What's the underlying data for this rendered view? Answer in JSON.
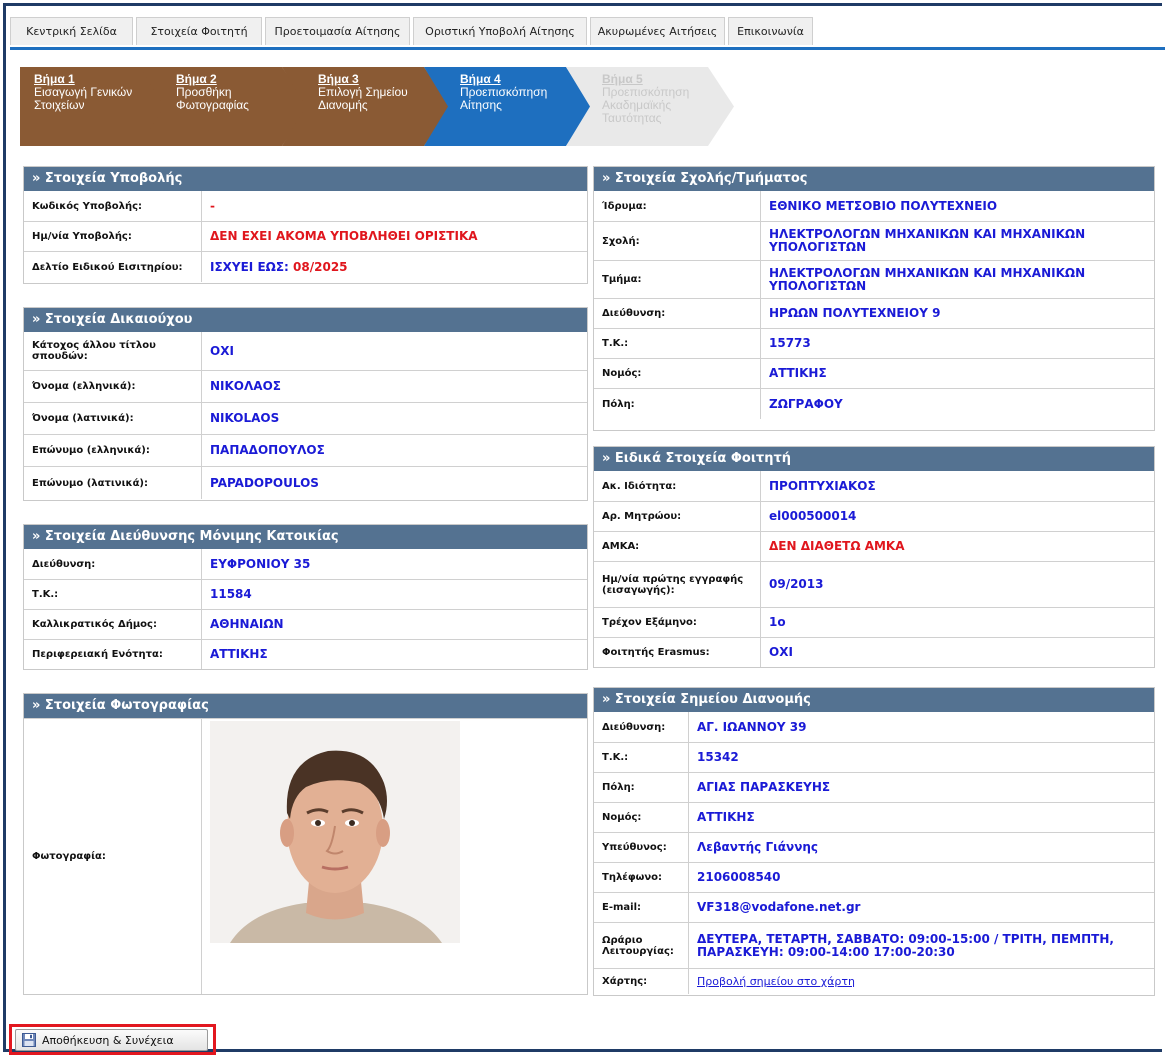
{
  "nav": {
    "tabs": [
      "Κεντρική Σελίδα",
      "Στοιχεία Φοιτητή",
      "Προετοιμασία Αίτησης",
      "Οριστική Υποβολή Αίτησης",
      "Ακυρωμένες Αιτήσεις",
      "Επικοινωνία"
    ]
  },
  "steps": [
    {
      "num": "Βήμα 1",
      "text": "Εισαγωγή Γενικών\nΣτοιχείων",
      "state": "done"
    },
    {
      "num": "Βήμα 2",
      "text": "Προσθήκη\nΦωτογραφίας",
      "state": "done"
    },
    {
      "num": "Βήμα 3",
      "text": "Επιλογή Σημείου\nΔιανομής",
      "state": "done"
    },
    {
      "num": "Βήμα 4",
      "text": "Προεπισκόπηση\nΑίτησης",
      "state": "current"
    },
    {
      "num": "Βήμα 5",
      "text": "Προεπισκόπηση\nΑκαδημαϊκής\nΤαυτότητας",
      "state": "disabled"
    }
  ],
  "submission": {
    "title": "» Στοιχεία Υποβολής",
    "code_label": "Κωδικός Υποβολής:",
    "code_value": "-",
    "date_label": "Ημ/νία Υποβολής:",
    "date_value": "ΔΕΝ ΕΧΕΙ ΑΚΟΜΑ ΥΠΟΒΛΗΘΕΙ ΟΡΙΣΤΙΚΑ",
    "ticket_label": "Δελτίο Ειδικού Εισιτηρίου:",
    "ticket_prefix": "ΙΣΧΥΕΙ ΕΩΣ:",
    "ticket_value": "08/2025"
  },
  "beneficiary": {
    "title": "» Στοιχεία Δικαιούχου",
    "rows": [
      {
        "label": "Κάτοχος άλλου τίτλου σπουδών:",
        "value": "ΟΧΙ"
      },
      {
        "label": "Όνομα (ελληνικά):",
        "value": "ΝΙΚΟΛΑΟΣ"
      },
      {
        "label": "Όνομα (λατινικά):",
        "value": "NIKOLAOS"
      },
      {
        "label": "Επώνυμο (ελληνικά):",
        "value": "ΠΑΠΑΔΟΠΟΥΛΟΣ"
      },
      {
        "label": "Επώνυμο (λατινικά):",
        "value": "PAPADOPOULOS"
      }
    ]
  },
  "residence": {
    "title": "» Στοιχεία Διεύθυνσης Μόνιμης Κατοικίας",
    "rows": [
      {
        "label": "Διεύθυνση:",
        "value": "ΕΥΦΡΟΝΙΟΥ 35"
      },
      {
        "label": "Τ.Κ.:",
        "value": "11584"
      },
      {
        "label": "Καλλικρατικός Δήμος:",
        "value": "ΑΘΗΝΑΙΩΝ"
      },
      {
        "label": "Περιφερειακή Ενότητα:",
        "value": "ΑΤΤΙΚΗΣ"
      }
    ]
  },
  "photo": {
    "title": "» Στοιχεία Φωτογραφίας",
    "label": "Φωτογραφία:"
  },
  "school": {
    "title": "» Στοιχεία Σχολής/Τμήματος",
    "rows": [
      {
        "label": "Ίδρυμα:",
        "value": "ΕΘΝΙΚΟ ΜΕΤΣΟΒΙΟ ΠΟΛΥΤΕΧΝΕΙΟ"
      },
      {
        "label": "Σχολή:",
        "value": "ΗΛΕΚΤΡΟΛΟΓΩΝ ΜΗΧΑΝΙΚΩΝ ΚΑΙ ΜΗΧΑΝΙΚΩΝ ΥΠΟΛΟΓΙΣΤΩΝ"
      },
      {
        "label": "Τμήμα:",
        "value": "ΗΛΕΚΤΡΟΛΟΓΩΝ ΜΗΧΑΝΙΚΩΝ ΚΑΙ ΜΗΧΑΝΙΚΩΝ ΥΠΟΛΟΓΙΣΤΩΝ"
      },
      {
        "label": "Διεύθυνση:",
        "value": "ΗΡΩΩΝ ΠΟΛΥΤΕΧΝΕΙΟΥ 9"
      },
      {
        "label": "Τ.Κ.:",
        "value": "15773"
      },
      {
        "label": "Νομός:",
        "value": "ΑΤΤΙΚΗΣ"
      },
      {
        "label": "Πόλη:",
        "value": "ΖΩΓΡΑΦΟΥ"
      }
    ]
  },
  "student": {
    "title": "» Ειδικά Στοιχεία Φοιτητή",
    "rows": [
      {
        "label": "Ακ. Ιδιότητα:",
        "value": "ΠΡΟΠΤΥΧΙΑΚΟΣ"
      },
      {
        "label": "Αρ. Μητρώου:",
        "value": "el000500014"
      },
      {
        "label": "ΑΜΚΑ:",
        "value": "ΔΕΝ ΔΙΑΘΕΤΩ ΑΜΚΑ"
      },
      {
        "label": "Ημ/νία πρώτης εγγραφής (εισαγωγής):",
        "value": "09/2013"
      },
      {
        "label": "Τρέχον Εξάμηνο:",
        "value": "1ο"
      },
      {
        "label": "Φοιτητής Erasmus:",
        "value": "ΟΧΙ"
      }
    ]
  },
  "delivery": {
    "title": "» Στοιχεία Σημείου Διανομής",
    "rows": [
      {
        "label": "Διεύθυνση:",
        "value": "ΑΓ. ΙΩΑΝΝΟΥ 39"
      },
      {
        "label": "Τ.Κ.:",
        "value": "15342"
      },
      {
        "label": "Πόλη:",
        "value": "ΑΓΙΑΣ ΠΑΡΑΣΚΕΥΗΣ"
      },
      {
        "label": "Νομός:",
        "value": "ΑΤΤΙΚΗΣ"
      },
      {
        "label": "Υπεύθυνος:",
        "value": "Λεβαντής Γιάννης"
      },
      {
        "label": "Τηλέφωνο:",
        "value": "2106008540"
      },
      {
        "label": "E-mail:",
        "value": "VF318@vodafone.net.gr"
      },
      {
        "label": "Ωράριο Λειτουργίας:",
        "value": "ΔΕΥΤΕΡΑ, ΤΕΤΑΡΤΗ, ΣΑΒΒΑΤΟ: 09:00-15:00 / ΤΡΙΤΗ, ΠΕΜΠΤΗ, ΠΑΡΑΣΚΕΥΗ: 09:00-14:00 17:00-20:30"
      },
      {
        "label": "Χάρτης:",
        "value": "Προβολή σημείου στο χάρτη"
      }
    ]
  },
  "save_button": {
    "label": "Αποθήκευση & Συνέχεια",
    "icon": "floppy-disk-icon"
  },
  "colors": {
    "panel_header": "#547291",
    "value_blue": "#1a1ad6",
    "value_red": "#e0161d",
    "step_done": "#8a5a34",
    "step_current": "#1e6fbf",
    "highlight": "#e2171f"
  }
}
